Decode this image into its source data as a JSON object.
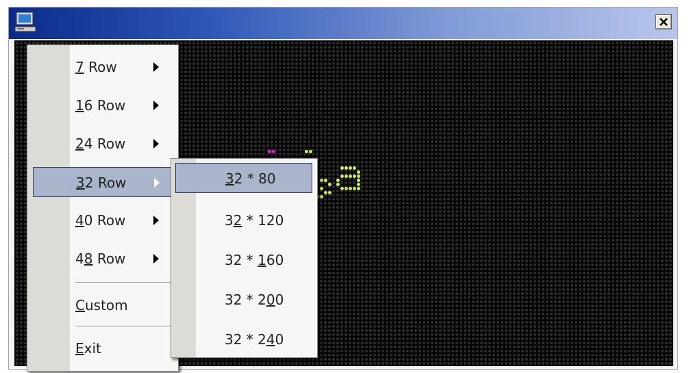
{
  "window": {
    "title": ""
  },
  "icons": {
    "app": "computer-icon",
    "close": "close-x-icon",
    "submenu": "submenu-arrow-icon"
  },
  "led_colors": {
    "magenta": "#e020e0",
    "yellow_green": "#c8f050"
  },
  "main_menu": {
    "items": [
      {
        "pre": "",
        "u": "7",
        "post": " Row",
        "submenu": true
      },
      {
        "pre": "",
        "u": "1",
        "post": "6 Row",
        "submenu": true
      },
      {
        "pre": "",
        "u": "2",
        "post": "4 Row",
        "submenu": true
      },
      {
        "pre": "",
        "u": "3",
        "post": "2 Row",
        "submenu": true
      },
      {
        "pre": "",
        "u": "4",
        "post": "0 Row",
        "submenu": true
      },
      {
        "pre": "4",
        "u": "8",
        "post": " Row",
        "submenu": true
      },
      {
        "pre": "",
        "u": "C",
        "post": "ustom",
        "submenu": false
      },
      {
        "pre": "",
        "u": "E",
        "post": "xit",
        "submenu": false
      }
    ],
    "highlighted": "32 Row"
  },
  "submenu": {
    "items": [
      {
        "pre": "",
        "u": "3",
        "post": "2 * 80"
      },
      {
        "pre": "3",
        "u": "2",
        "post": " * 120"
      },
      {
        "pre": "32 * ",
        "u": "1",
        "post": "60"
      },
      {
        "pre": "32 * 2",
        "u": "0",
        "post": "0"
      },
      {
        "pre": "32 * 2",
        "u": "4",
        "post": "0"
      }
    ],
    "highlighted": "32 * 80"
  }
}
